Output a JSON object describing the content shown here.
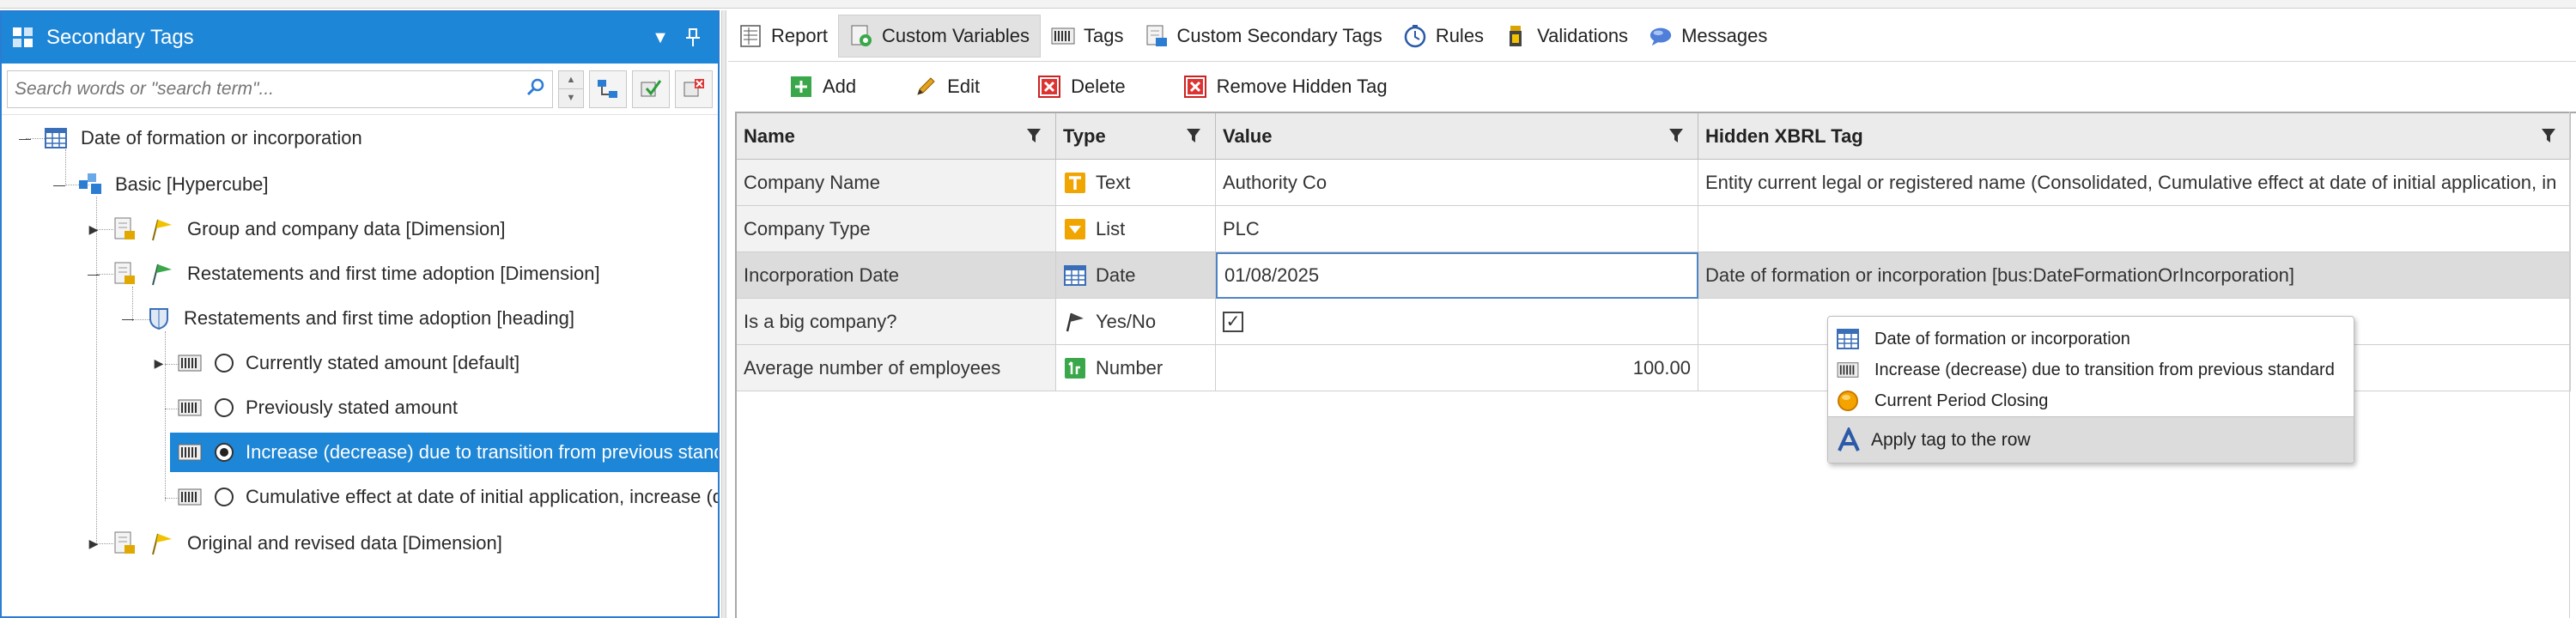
{
  "left_panel": {
    "title": "Secondary Tags",
    "search_placeholder": "Search words or \"search term\"...",
    "tree": [
      {
        "label": "Date of formation or incorporation",
        "icon": "calendar-grid-icon"
      },
      {
        "label": "Basic [Hypercube]",
        "icon": "hypercube-icon"
      },
      {
        "label": "Group and company data [Dimension]",
        "icon": "dimension-flag-icon"
      },
      {
        "label": "Restatements and first time adoption [Dimension]",
        "icon": "dimension-flag-green-icon"
      },
      {
        "label": "Restatements and first time adoption [heading]",
        "icon": "heading-shield-icon"
      },
      {
        "label": "Currently stated amount [default]",
        "icon": "barcode-icon"
      },
      {
        "label": "Previously stated amount",
        "icon": "barcode-icon"
      },
      {
        "label": "Increase (decrease) due to transition from previous standard",
        "icon": "barcode-icon"
      },
      {
        "label": "Cumulative effect at date of initial application, increase (decrease)",
        "icon": "barcode-icon"
      },
      {
        "label": "Original and revised data [Dimension]",
        "icon": "dimension-flag-icon"
      }
    ]
  },
  "tabs": [
    {
      "label": "Report",
      "icon": "report-icon"
    },
    {
      "label": "Custom Variables",
      "icon": "custom-variables-icon"
    },
    {
      "label": "Tags",
      "icon": "tags-icon"
    },
    {
      "label": "Custom Secondary Tags",
      "icon": "custom-secondary-tags-icon"
    },
    {
      "label": "Rules",
      "icon": "rules-clock-icon"
    },
    {
      "label": "Validations",
      "icon": "validations-icon"
    },
    {
      "label": "Messages",
      "icon": "messages-icon"
    }
  ],
  "toolbar": {
    "add": "Add",
    "edit": "Edit",
    "delete": "Delete",
    "remove_hidden_tag": "Remove Hidden Tag"
  },
  "grid": {
    "headers": [
      "Name",
      "Type",
      "Value",
      "Hidden XBRL Tag"
    ],
    "rows": [
      {
        "name": "Company Name",
        "type": "Text",
        "type_icon": "text-type-icon",
        "value": "Authority Co",
        "hidden_tag": "Entity current legal or registered name (Consolidated, Cumulative effect at date of initial application, in"
      },
      {
        "name": "Company Type",
        "type": "List",
        "type_icon": "list-type-icon",
        "value": "PLC",
        "hidden_tag": ""
      },
      {
        "name": "Incorporation Date",
        "type": "Date",
        "type_icon": "date-type-icon",
        "value": "01/08/2025",
        "hidden_tag": "Date of formation or incorporation [bus:DateFormationOrIncorporation]"
      },
      {
        "name": "Is a big company?",
        "type": "Yes/No",
        "type_icon": "yesno-flag-icon",
        "value": "",
        "checked": true,
        "hidden_tag": ""
      },
      {
        "name": "Average number of employees",
        "type": "Number",
        "type_icon": "number-type-icon",
        "value": "100.00",
        "hidden_tag": ""
      }
    ]
  },
  "popup": {
    "items": [
      {
        "label": "Date of formation or incorporation",
        "icon": "calendar-grid-icon"
      },
      {
        "label": "Increase (decrease) due to transition from previous standard",
        "icon": "barcode-icon"
      },
      {
        "label": "Current Period Closing",
        "icon": "period-closing-icon"
      }
    ],
    "apply_label": "Apply tag to the row"
  },
  "colors": {
    "accent": "#1e86d6",
    "selected_row": "#dcdcdc",
    "header_bg": "#ebebeb"
  }
}
